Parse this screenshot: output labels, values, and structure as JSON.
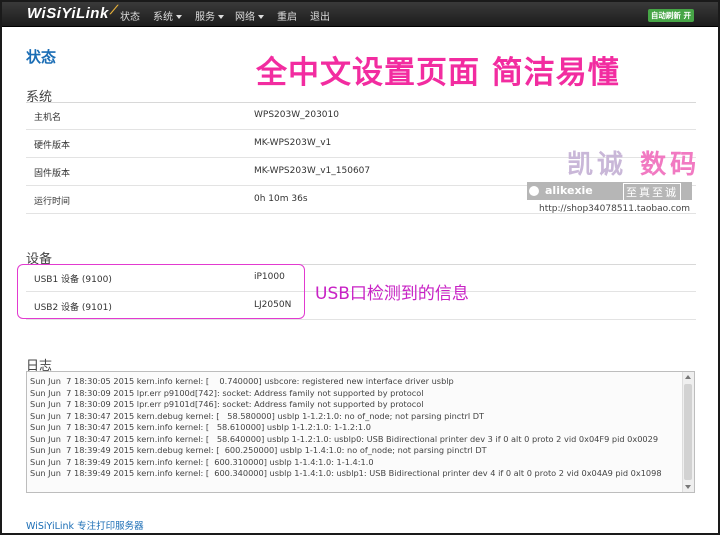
{
  "navbar": {
    "brand": "WiSiYiLink",
    "items": [
      {
        "label": "状态",
        "dropdown": false
      },
      {
        "label": "系统",
        "dropdown": true
      },
      {
        "label": "服务",
        "dropdown": true
      },
      {
        "label": "网络",
        "dropdown": true
      },
      {
        "label": "重启",
        "dropdown": false
      },
      {
        "label": "退出",
        "dropdown": false
      }
    ],
    "refresh_badge": "自动刷新 开"
  },
  "page_title": "状态",
  "promo_banner": "全中文设置页面  简洁易懂",
  "system": {
    "title": "系统",
    "rows": [
      {
        "key": "主机名",
        "value": "WPS203W_203010"
      },
      {
        "key": "硬件版本",
        "value": "MK-WPS203W_v1"
      },
      {
        "key": "固件版本",
        "value": "MK-WPS203W_v1_150607"
      },
      {
        "key": "运行时间",
        "value": "0h 10m 36s"
      }
    ]
  },
  "watermark": {
    "brand_cn_1": "凯诚",
    "brand_cn_2": "数码",
    "bar_en": "alikexie",
    "bar_cn": "至真至诚",
    "url": "http://shop34078511.taobao.com"
  },
  "devices": {
    "title": "设备",
    "rows": [
      {
        "key": "USB1 设备 (9100)",
        "value": "iP1000"
      },
      {
        "key": "USB2 设备 (9101)",
        "value": "LJ2050N"
      }
    ],
    "note": "USB口检测到的信息"
  },
  "log": {
    "title": "日志",
    "lines": [
      "Sun Jun  7 18:30:05 2015 kern.info kernel: [    0.740000] usbcore: registered new interface driver usblp",
      "Sun Jun  7 18:30:09 2015 lpr.err p9100d[742]: socket: Address family not supported by protocol",
      "Sun Jun  7 18:30:09 2015 lpr.err p9101d[746]: socket: Address family not supported by protocol",
      "Sun Jun  7 18:30:47 2015 kern.debug kernel: [   58.580000] usblp 1-1.2:1.0: no of_node; not parsing pinctrl DT",
      "Sun Jun  7 18:30:47 2015 kern.info kernel: [   58.610000] usblp 1-1.2:1.0: 1-1.2:1.0",
      "Sun Jun  7 18:30:47 2015 kern.info kernel: [   58.640000] usblp 1-1.2:1.0: usblp0: USB Bidirectional printer dev 3 if 0 alt 0 proto 2 vid 0x04F9 pid 0x0029",
      "Sun Jun  7 18:39:49 2015 kern.debug kernel: [  600.250000] usblp 1-1.4:1.0: no of_node; not parsing pinctrl DT",
      "Sun Jun  7 18:39:49 2015 kern.info kernel: [  600.310000] usblp 1-1.4:1.0: 1-1.4:1.0",
      "Sun Jun  7 18:39:49 2015 kern.info kernel: [  600.340000] usblp 1-1.4:1.0: usblp1: USB Bidirectional printer dev 4 if 0 alt 0 proto 2 vid 0x04A9 pid 0x1098"
    ]
  },
  "footer": "WiSiYiLink 专注打印服务器"
}
